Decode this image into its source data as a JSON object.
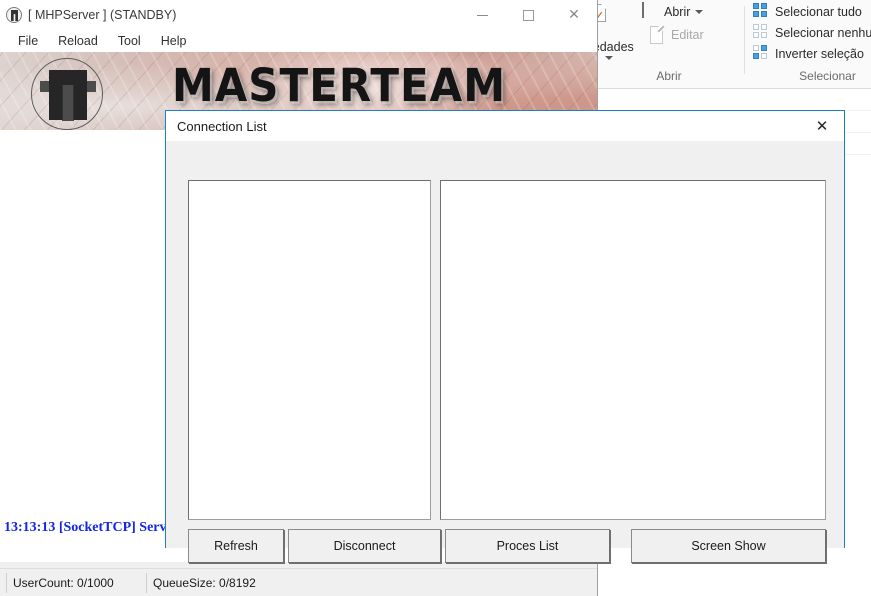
{
  "explorer": {
    "ribbon": {
      "groups": [
        {
          "label": "Abrir",
          "items": [
            {
              "label": "Propriedades",
              "icon": "properties-icon",
              "dim": false,
              "truncated": "iedades"
            },
            {
              "label": "Abrir",
              "icon": "open-icon",
              "dim": false,
              "dropdown": true
            },
            {
              "label": "Editar",
              "icon": "edit-icon",
              "dim": true
            }
          ]
        },
        {
          "label": "Selecionar",
          "items": [
            {
              "label": "Selecionar tudo",
              "icon": "select-all-icon"
            },
            {
              "label": "Selecionar nenhum",
              "icon": "select-none-icon"
            },
            {
              "label": "Inverter seleção",
              "icon": "invert-selection-icon"
            }
          ]
        }
      ]
    }
  },
  "mhp_window": {
    "title": "[ MHPServer ] (STANDBY)",
    "app_icon": "mhpserver-icon",
    "window_controls": {
      "minimize": "minimize-icon",
      "maximize": "maximize-icon",
      "close": "close-icon"
    },
    "menu": [
      {
        "label": "File"
      },
      {
        "label": "Reload"
      },
      {
        "label": "Tool"
      },
      {
        "label": "Help"
      }
    ],
    "banner": {
      "logo_icon": "masterteam-logo-icon",
      "title": "MASTERTEAM"
    },
    "log": {
      "lines": [
        "13:13:13 [SocketTCP] Serv"
      ]
    },
    "statusbar": {
      "user_count": "UserCount: 0/1000",
      "queue_size": "QueueSize: 0/8192"
    }
  },
  "dialog": {
    "title": "Connection List",
    "close_icon": "close-icon",
    "lists": {
      "connections": {
        "items": []
      },
      "details": {
        "items": []
      }
    },
    "buttons": [
      {
        "label": "Refresh"
      },
      {
        "label": "Disconnect"
      },
      {
        "label": "Proces List"
      },
      {
        "label": "Screen Show"
      }
    ]
  },
  "colors": {
    "dialog_border": "#1d7ec4",
    "log_text": "#1226e8",
    "ribbon_accent": "#4a9fdc"
  }
}
